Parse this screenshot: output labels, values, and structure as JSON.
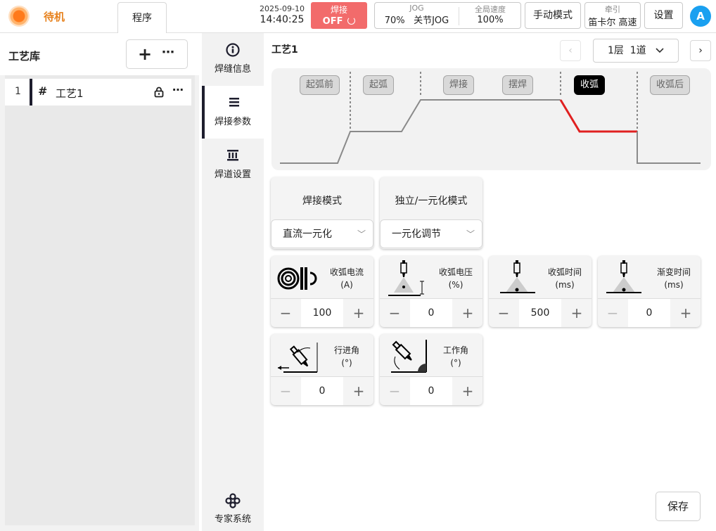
{
  "header": {
    "status": "待机",
    "program_tab": "程序",
    "date": "2025-09-10",
    "time": "14:40:25",
    "weld_label": "焊接",
    "weld_state": "OFF",
    "jog_label": "JOG",
    "jog_speed": "70%",
    "jog_mode": "关节JOG",
    "global_speed_label": "全局速度",
    "global_speed": "100%",
    "manual_mode": "手动模式",
    "traction_label": "牵引",
    "traction_value": "笛卡尔 高速",
    "settings": "设置",
    "avatar": "A"
  },
  "library": {
    "title": "工艺库",
    "items": [
      {
        "index": "1",
        "name": "工艺1"
      }
    ]
  },
  "nav": [
    {
      "label": "焊缝信息",
      "icon": "info-icon"
    },
    {
      "label": "焊接参数",
      "icon": "list-icon"
    },
    {
      "label": "焊道设置",
      "icon": "layers-icon"
    },
    {
      "label": "专家系统",
      "icon": "expert-icon"
    }
  ],
  "main": {
    "title": "工艺1",
    "layer_selector": "1层  1道",
    "phases": [
      "起弧前",
      "起弧",
      "焊接",
      "摆焊",
      "收弧",
      "收弧后"
    ],
    "active_phase": "收弧",
    "welding_mode_label": "焊接模式",
    "welding_mode_value": "直流一元化",
    "unified_mode_label": "独立/一元化模式",
    "unified_mode_value": "一元化调节",
    "params": [
      {
        "name": "收弧电流",
        "unit": "(A)",
        "value": "100",
        "icon": "current-coil-icon"
      },
      {
        "name": "收弧电压",
        "unit": "(%)",
        "value": "0",
        "icon": "torch-voltage-icon"
      },
      {
        "name": "收弧时间",
        "unit": "(ms)",
        "value": "500",
        "icon": "torch-time-icon"
      },
      {
        "name": "渐变时间",
        "unit": "(ms)",
        "value": "0",
        "icon": "torch-ramp-icon"
      },
      {
        "name": "行进角",
        "unit": "(°)",
        "value": "0",
        "icon": "travel-angle-icon"
      },
      {
        "name": "工作角",
        "unit": "(°)",
        "value": "0",
        "icon": "work-angle-icon"
      }
    ],
    "save": "保存"
  },
  "colors": {
    "status": "#e7821e",
    "weld_off": "#f26b6b",
    "avatar": "#1aa0f0",
    "curve_active": "#e02020"
  }
}
